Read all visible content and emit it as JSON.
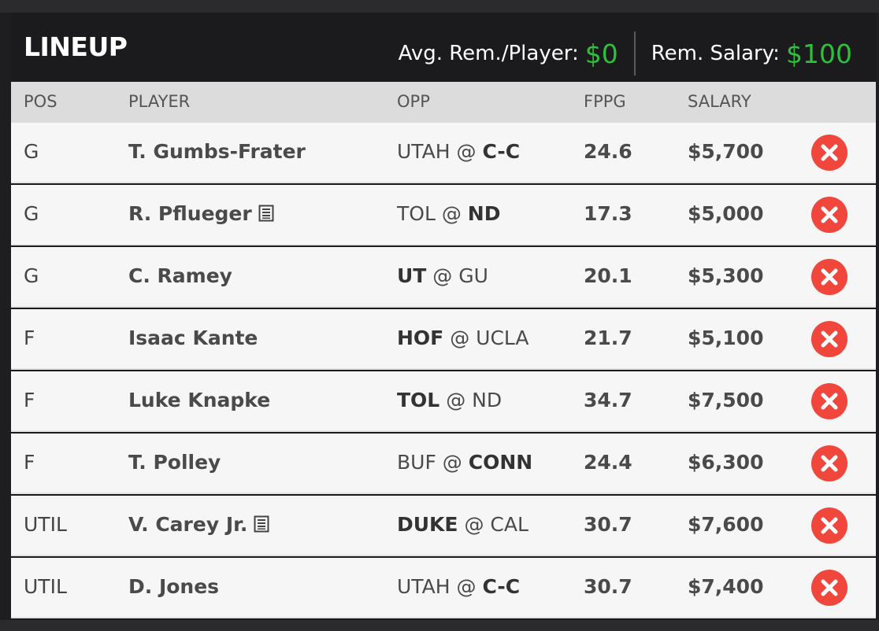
{
  "header": {
    "title": "LINEUP",
    "avg_rem_label": "Avg. Rem./Player:",
    "avg_rem_value": "$0",
    "rem_salary_label": "Rem. Salary:",
    "rem_salary_value": "$100"
  },
  "columns": {
    "pos": "POS",
    "player": "PLAYER",
    "opp": "OPP",
    "fppg": "FPPG",
    "salary": "SALARY"
  },
  "rows": [
    {
      "pos": "G",
      "player": "T. Gumbs-Frater",
      "news": false,
      "opp_left": "UTAH",
      "opp_sep": " @ ",
      "opp_right": "C-C",
      "bold": "right",
      "fppg": "24.6",
      "salary": "$5,700"
    },
    {
      "pos": "G",
      "player": "R. Pflueger",
      "news": true,
      "opp_left": "TOL",
      "opp_sep": " @ ",
      "opp_right": "ND",
      "bold": "right",
      "fppg": "17.3",
      "salary": "$5,000"
    },
    {
      "pos": "G",
      "player": "C. Ramey",
      "news": false,
      "opp_left": "UT",
      "opp_sep": " @ ",
      "opp_right": "GU",
      "bold": "left",
      "fppg": "20.1",
      "salary": "$5,300"
    },
    {
      "pos": "F",
      "player": "Isaac Kante",
      "news": false,
      "opp_left": "HOF",
      "opp_sep": " @ ",
      "opp_right": "UCLA",
      "bold": "left",
      "fppg": "21.7",
      "salary": "$5,100"
    },
    {
      "pos": "F",
      "player": "Luke Knapke",
      "news": false,
      "opp_left": "TOL",
      "opp_sep": " @ ",
      "opp_right": "ND",
      "bold": "left",
      "fppg": "34.7",
      "salary": "$7,500"
    },
    {
      "pos": "F",
      "player": "T. Polley",
      "news": false,
      "opp_left": "BUF",
      "opp_sep": " @ ",
      "opp_right": "CONN",
      "bold": "right",
      "fppg": "24.4",
      "salary": "$6,300"
    },
    {
      "pos": "UTIL",
      "player": "V. Carey Jr.",
      "news": true,
      "opp_left": "DUKE",
      "opp_sep": " @ ",
      "opp_right": "CAL",
      "bold": "left",
      "fppg": "30.7",
      "salary": "$7,600"
    },
    {
      "pos": "UTIL",
      "player": "D. Jones",
      "news": false,
      "opp_left": "UTAH",
      "opp_sep": " @ ",
      "opp_right": "C-C",
      "bold": "right",
      "fppg": "30.7",
      "salary": "$7,400"
    }
  ],
  "icons": {
    "remove": "remove-player-icon",
    "news": "player-news-icon"
  },
  "colors": {
    "accent_green": "#2fbf3b",
    "remove_red": "#f1463b",
    "header_bg": "#1b1b1d",
    "column_header_bg": "#dcdcdc",
    "row_bg": "#f6f6f6"
  }
}
